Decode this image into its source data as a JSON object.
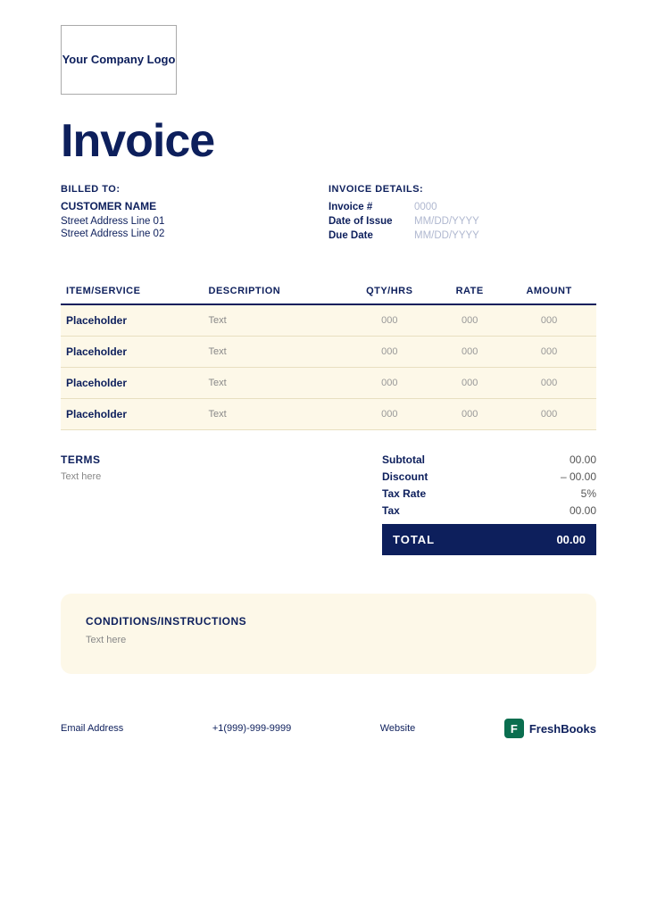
{
  "logo": {
    "text": "Your Company Logo"
  },
  "invoice": {
    "title": "Invoice"
  },
  "billed_to": {
    "label": "BILLED TO:",
    "customer_name": "CUSTOMER NAME",
    "address_line1": "Street Address Line 01",
    "address_line2": "Street Address Line 02"
  },
  "invoice_details": {
    "label": "INVOICE DETAILS:",
    "fields": [
      {
        "key": "Invoice #",
        "value": "0000"
      },
      {
        "key": "Date of Issue",
        "value": "MM/DD/YYYY"
      },
      {
        "key": "Due Date",
        "value": "MM/DD/YYYY"
      }
    ]
  },
  "table": {
    "headers": [
      "ITEM/SERVICE",
      "DESCRIPTION",
      "QTY/HRS",
      "RATE",
      "AMOUNT"
    ],
    "rows": [
      {
        "item": "Placeholder",
        "description": "Text",
        "qty": "000",
        "rate": "000",
        "amount": "000"
      },
      {
        "item": "Placeholder",
        "description": "Text",
        "qty": "000",
        "rate": "000",
        "amount": "000"
      },
      {
        "item": "Placeholder",
        "description": "Text",
        "qty": "000",
        "rate": "000",
        "amount": "000"
      },
      {
        "item": "Placeholder",
        "description": "Text",
        "qty": "000",
        "rate": "000",
        "amount": "000"
      }
    ]
  },
  "terms": {
    "label": "TERMS",
    "text": "Text here"
  },
  "totals": {
    "subtotal_label": "Subtotal",
    "subtotal_value": "00.00",
    "discount_label": "Discount",
    "discount_value": "– 00.00",
    "taxrate_label": "Tax Rate",
    "taxrate_value": "5%",
    "tax_label": "Tax",
    "tax_value": "00.00",
    "total_label": "TOTAL",
    "total_value": "00.00"
  },
  "conditions": {
    "label": "CONDITIONS/INSTRUCTIONS",
    "text": "Text here"
  },
  "footer": {
    "email": "Email Address",
    "phone": "+1(999)-999-9999",
    "website": "Website",
    "brand": "FreshBooks",
    "brand_icon": "F"
  }
}
